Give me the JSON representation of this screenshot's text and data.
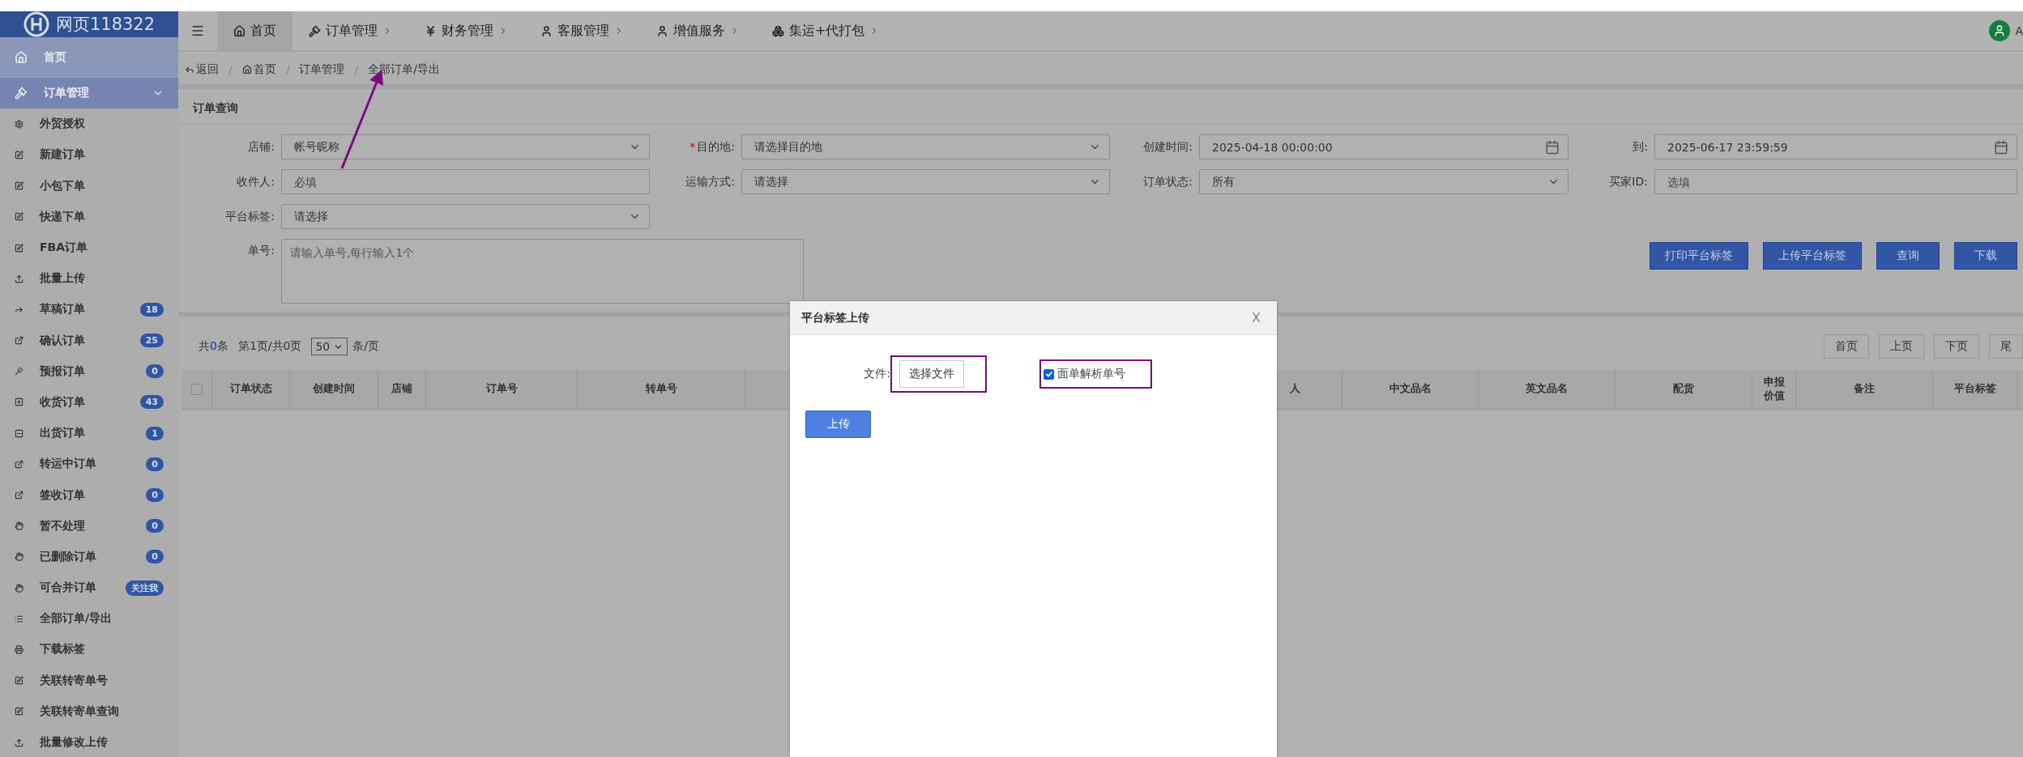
{
  "logo": {
    "text": "网页118322"
  },
  "nav": [
    {
      "label": "首页",
      "selected": true,
      "caret": false
    },
    {
      "label": "订单管理",
      "selected": false,
      "caret": true
    },
    {
      "label": "财务管理",
      "selected": false,
      "caret": true
    },
    {
      "label": "客服管理",
      "selected": false,
      "caret": true
    },
    {
      "label": "增值服务",
      "selected": false,
      "caret": true
    },
    {
      "label": "集运+代打包",
      "selected": false,
      "caret": true
    }
  ],
  "user": {
    "name": "A"
  },
  "sidebar": {
    "items": [
      {
        "label": "首页",
        "expanded": false
      },
      {
        "label": "订单管理",
        "expanded": true,
        "children": [
          {
            "label": "外贸授权"
          },
          {
            "label": "新建订单"
          },
          {
            "label": "小包下单"
          },
          {
            "label": "快递下单"
          },
          {
            "label": "FBA订单"
          },
          {
            "label": "批量上传"
          },
          {
            "label": "草稿订单",
            "badge": "18"
          },
          {
            "label": "确认订单",
            "badge": "25"
          },
          {
            "label": "预报订单",
            "badge": "0"
          },
          {
            "label": "收货订单",
            "badge": "43"
          },
          {
            "label": "出货订单",
            "badge": "1"
          },
          {
            "label": "转运中订单",
            "badge": "0"
          },
          {
            "label": "签收订单",
            "badge": "0"
          },
          {
            "label": "暂不处理",
            "badge": "0"
          },
          {
            "label": "已删除订单",
            "badge": "0"
          },
          {
            "label": "可合并订单",
            "badge": "关注我"
          },
          {
            "label": "全部订单/导出"
          },
          {
            "label": "下载标签"
          },
          {
            "label": "关联转寄单号"
          },
          {
            "label": "关联转寄单查询"
          },
          {
            "label": "批量修改上传"
          }
        ]
      }
    ]
  },
  "breadcrumb": [
    {
      "label": "返回"
    },
    {
      "separator": "/",
      "label": "首页"
    },
    {
      "separator": "/",
      "label": "订单管理"
    },
    {
      "separator": "/",
      "label": "全部订单/导出"
    }
  ],
  "query_panel": {
    "title": "订单查询",
    "fields": [
      {
        "label": "店铺:",
        "kind": "select",
        "value": "帐号昵称"
      },
      {
        "required_mark": "*",
        "label": "目的地:",
        "kind": "select",
        "value": "请选择目的地"
      },
      {
        "label": "创建时间:",
        "kind": "date",
        "value": "2025-04-18 00:00:00"
      },
      {
        "label": "到:",
        "kind": "date",
        "value": "2025-06-17 23:59:59"
      },
      {
        "label": "收件人:",
        "kind": "text",
        "placeholder": "必填"
      },
      {
        "label": "运输方式:",
        "kind": "select",
        "value": "请选择"
      },
      {
        "label": "订单状态:",
        "kind": "select",
        "value": "所有"
      },
      {
        "label": "买家ID:",
        "kind": "text",
        "placeholder": "选填"
      },
      {
        "label": "平台标签:",
        "kind": "select",
        "value": "请选择"
      }
    ],
    "order_numbers": {
      "label": "单号:",
      "placeholder": "请输入单号,每行输入1个"
    },
    "buttons": [
      "打印平台标签",
      "上传平台标签",
      "查询",
      "下载"
    ]
  },
  "table": {
    "total": {
      "prefix": "共",
      "count": "0",
      "suffix": "条"
    },
    "page_info": "第1页/共0页",
    "page_size": "50",
    "page_size_suffix": "条/页",
    "pager": [
      "首页",
      "上页",
      "下页",
      "尾"
    ],
    "select_all": {
      "checked": false
    },
    "columns": [
      "订单状态",
      "创建时间",
      "店铺",
      "订单号",
      "转单号",
      "",
      "人",
      "中文品名",
      "英文品名",
      "配货",
      "申报价值",
      "备注",
      "平台标签"
    ]
  },
  "annotation": {
    "kind": "arrow"
  },
  "modal": {
    "title": "平台标签上传",
    "close": "X",
    "file_label": "文件:",
    "file_button": "选择文件",
    "parse": {
      "label": "面单解析单号",
      "checked": true
    },
    "upload": "上传"
  }
}
